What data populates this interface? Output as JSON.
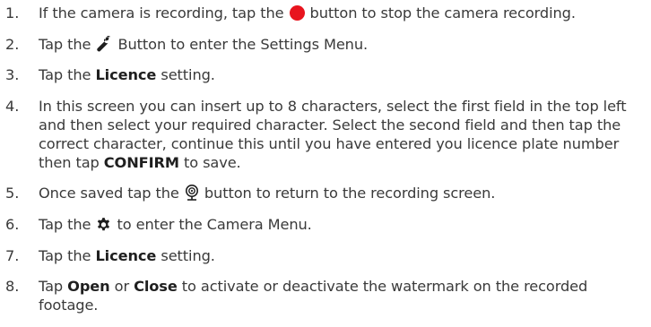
{
  "steps": [
    {
      "number": "1.",
      "text_before": "If the camera is recording, tap the ",
      "icon": "record-button-icon",
      "text_after": " button to stop the camera recording."
    },
    {
      "number": "2.",
      "text_before": "Tap the ",
      "icon": "wrench-icon",
      "text_after": " Button to enter the Settings Menu."
    },
    {
      "number": "3.",
      "text_before": "Tap the ",
      "bold": "Licence",
      "text_after": " setting."
    },
    {
      "number": "4.",
      "text_before": "In this screen you can insert up to 8 characters, select the first field in the top left and then select your required character. Select the second field and then tap the correct character, continue this until you have entered you licence plate number then tap ",
      "bold": "CONFIRM",
      "text_after": " to save."
    },
    {
      "number": "5.",
      "text_before": "Once saved tap the ",
      "icon": "camera-lens-icon",
      "text_after": " button to return to the recording screen."
    },
    {
      "number": "6.",
      "text_before": "Tap the ",
      "icon": "gear-icon",
      "text_after": " to enter the Camera Menu."
    },
    {
      "number": "7.",
      "text_before": "Tap the ",
      "bold": "Licence",
      "text_after": " setting."
    },
    {
      "number": "8.",
      "text_before": "Tap ",
      "bold": "Open",
      "text_middle": " or ",
      "bold2": "Close",
      "text_after": " to activate or deactivate the watermark on the recorded footage."
    }
  ],
  "colors": {
    "text": "#3a3a3a",
    "record_icon": "#e8141e",
    "icon_dark": "#1f1f1f"
  }
}
